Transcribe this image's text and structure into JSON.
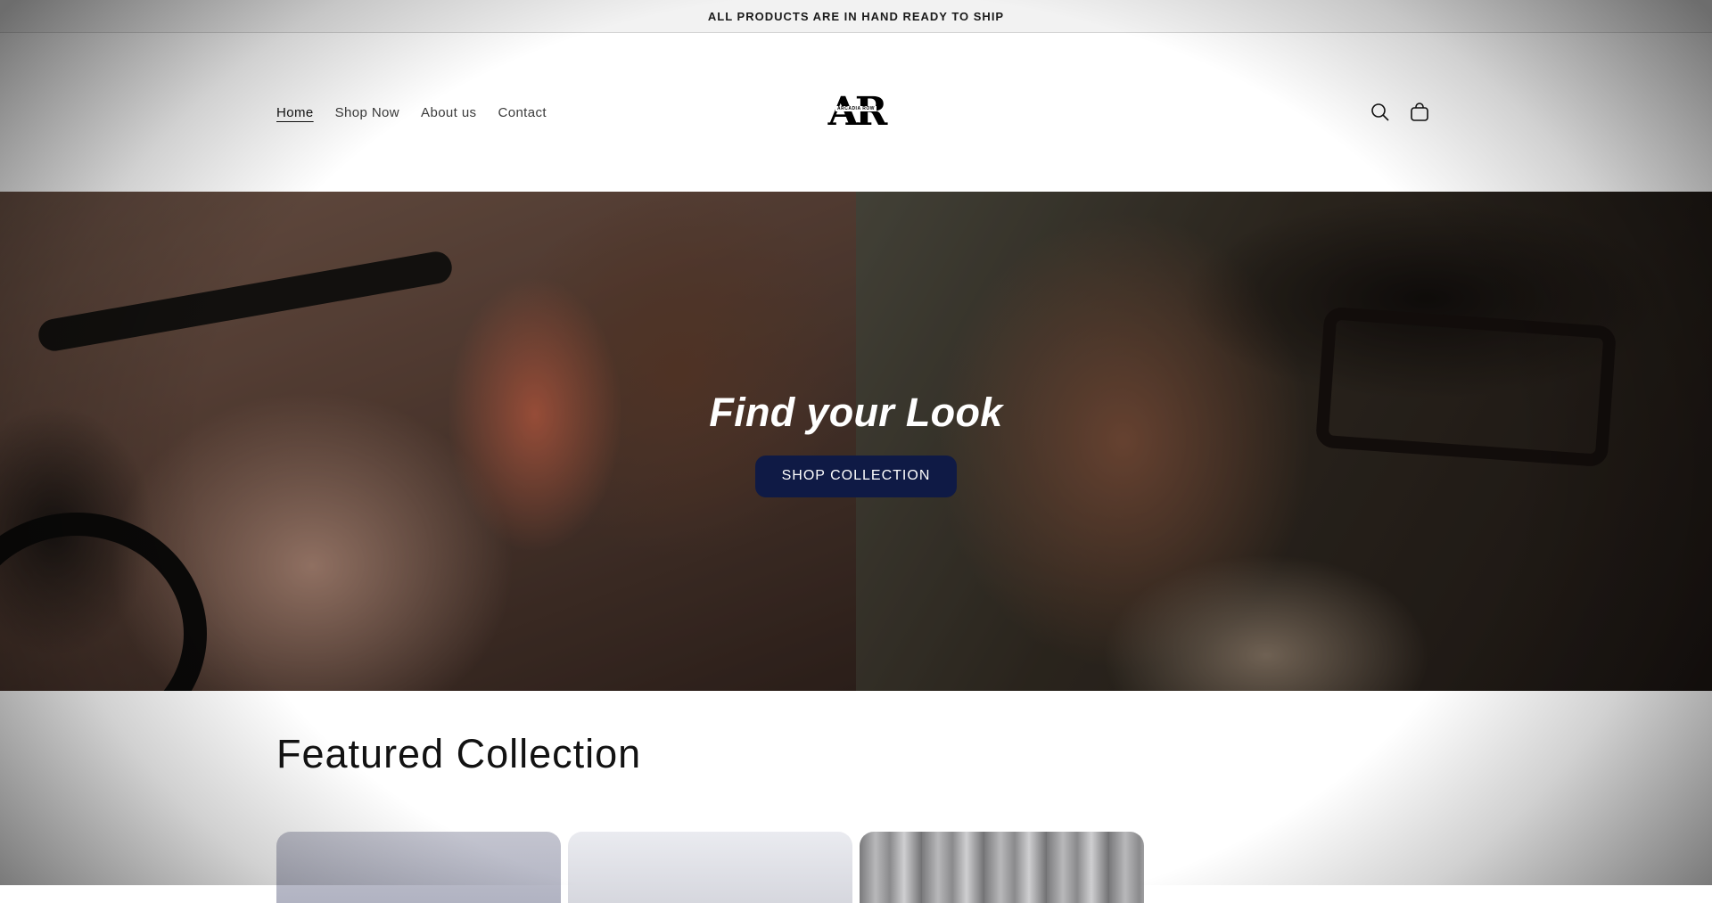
{
  "announcement": {
    "text": "ALL PRODUCTS ARE IN HAND READY TO SHIP"
  },
  "header": {
    "nav": [
      {
        "label": "Home",
        "active": true
      },
      {
        "label": "Shop Now",
        "active": false
      },
      {
        "label": "About us",
        "active": false
      },
      {
        "label": "Contact",
        "active": false
      }
    ],
    "logo": {
      "letters": "AR",
      "subtitle": "ARCADIA ROW"
    },
    "icons": [
      "search-icon",
      "cart-icon"
    ]
  },
  "hero": {
    "title": "Find your Look",
    "cta_label": "SHOP COLLECTION",
    "cta_color": "#0f1a45"
  },
  "featured": {
    "title": "Featured Collection",
    "cards": [
      {
        "name": "product-card"
      },
      {
        "name": "product-card"
      },
      {
        "name": "product-card"
      }
    ]
  }
}
